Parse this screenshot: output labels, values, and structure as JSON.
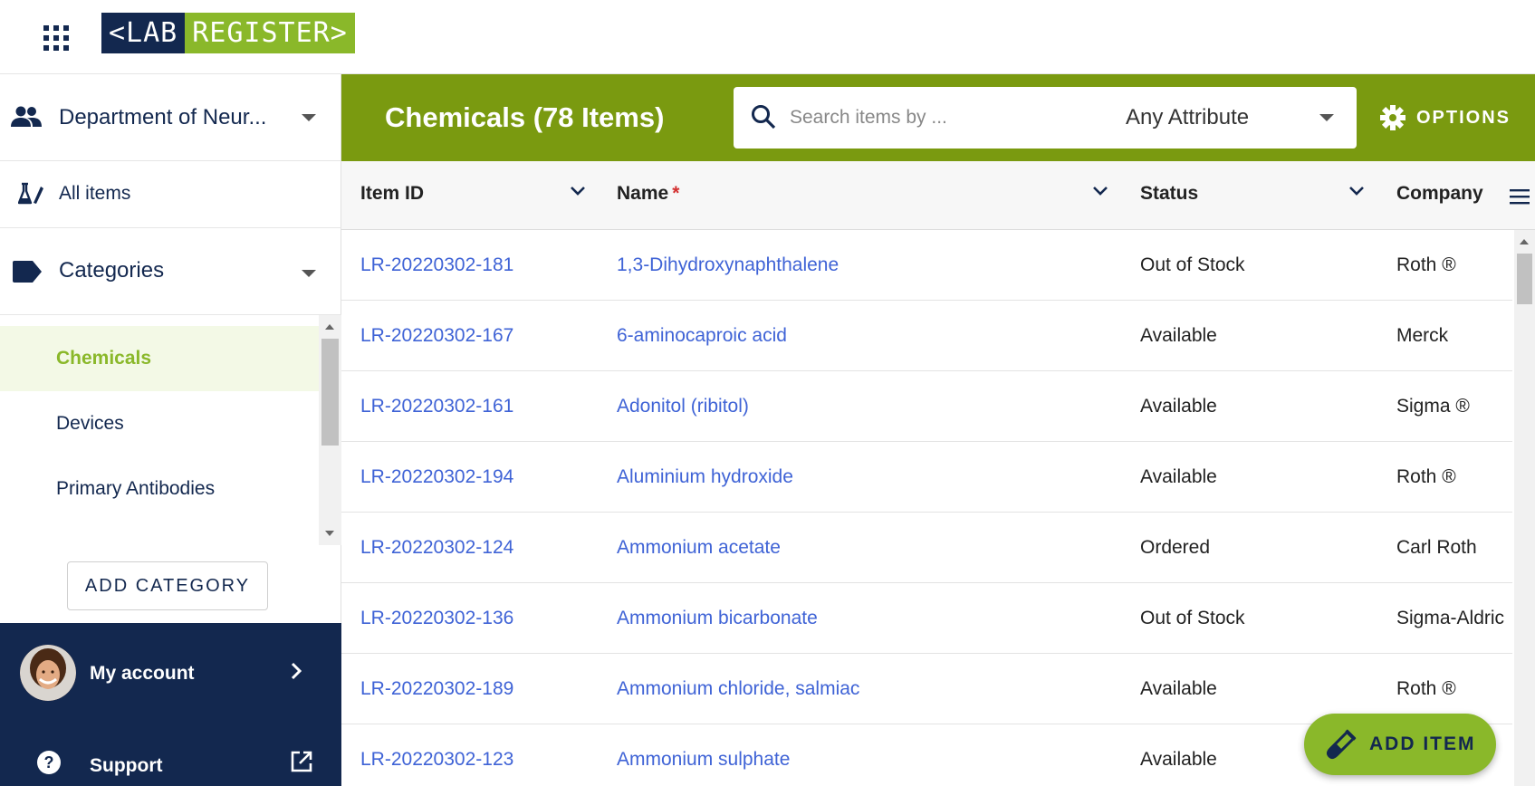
{
  "logo": {
    "lab": "<LAB",
    "register": "REGISTER>"
  },
  "sidebar": {
    "department": "Department of Neur...",
    "all_items": "All items",
    "categories_label": "Categories",
    "categories": [
      {
        "label": "Chemicals",
        "active": true
      },
      {
        "label": "Devices",
        "active": false
      },
      {
        "label": "Primary Antibodies",
        "active": false
      }
    ],
    "add_category": "ADD CATEGORY",
    "my_account": "My account",
    "support": "Support"
  },
  "header": {
    "title": "Chemicals (78 Items)",
    "search_placeholder": "Search items by ...",
    "attribute": "Any Attribute",
    "options": "OPTIONS"
  },
  "table": {
    "columns": [
      "Item ID",
      "Name",
      "Status",
      "Company"
    ],
    "name_required_marker": "*",
    "rows": [
      {
        "id": "LR-20220302-181",
        "name": "1,3-Dihydroxynaphthalene",
        "status": "Out of Stock",
        "company": "Roth ®"
      },
      {
        "id": "LR-20220302-167",
        "name": "6-aminocaproic acid",
        "status": "Available",
        "company": "Merck"
      },
      {
        "id": "LR-20220302-161",
        "name": "Adonitol (ribitol)",
        "status": "Available",
        "company": "Sigma ®"
      },
      {
        "id": "LR-20220302-194",
        "name": "Aluminium hydroxide",
        "status": "Available",
        "company": "Roth ®"
      },
      {
        "id": "LR-20220302-124",
        "name": "Ammonium acetate",
        "status": "Ordered",
        "company": "Carl Roth"
      },
      {
        "id": "LR-20220302-136",
        "name": "Ammonium bicarbonate",
        "status": "Out of Stock",
        "company": "Sigma-Aldric"
      },
      {
        "id": "LR-20220302-189",
        "name": "Ammonium chloride, salmiac",
        "status": "Available",
        "company": "Roth ®"
      },
      {
        "id": "LR-20220302-123",
        "name": "Ammonium sulphate",
        "status": "Available",
        "company": ""
      }
    ]
  },
  "fab": {
    "label": "ADD ITEM"
  },
  "colors": {
    "navy": "#13284f",
    "green": "#8ab82a",
    "header_green": "#7a9a10",
    "link": "#3f63d6"
  }
}
